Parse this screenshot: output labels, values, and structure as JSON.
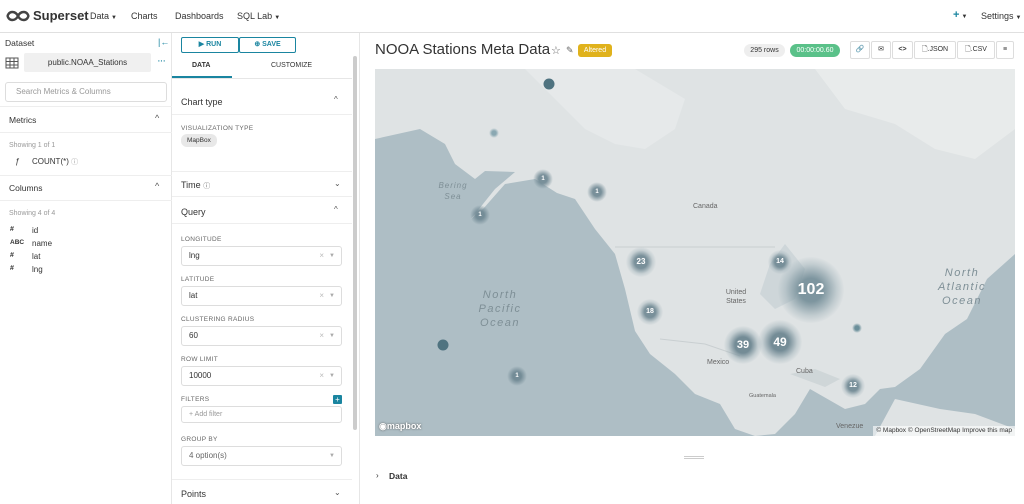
{
  "nav": {
    "brand": "Superset",
    "items": [
      "Data",
      "Charts",
      "Dashboards",
      "SQL Lab"
    ],
    "plus": "+",
    "settings": "Settings"
  },
  "dataset": {
    "heading": "Dataset",
    "name": "public.NOAA_Stations",
    "search_placeholder": "Search Metrics & Columns",
    "metrics_heading": "Metrics",
    "metrics_count": "Showing 1 of 1",
    "metric": "COUNT(*)",
    "columns_heading": "Columns",
    "columns_count": "Showing 4 of 4",
    "columns": [
      {
        "type": "#",
        "name": "id"
      },
      {
        "type": "ABC",
        "name": "name"
      },
      {
        "type": "#",
        "name": "lat"
      },
      {
        "type": "#",
        "name": "lng"
      }
    ]
  },
  "controls": {
    "run": "RUN",
    "save": "SAVE",
    "tab_data": "DATA",
    "tab_customize": "CUSTOMIZE",
    "chart_type": "Chart type",
    "viz_label": "VISUALIZATION TYPE",
    "viz_value": "MapBox",
    "time": "Time",
    "query": "Query",
    "longitude_label": "LONGITUDE",
    "longitude": "lng",
    "latitude_label": "LATITUDE",
    "latitude": "lat",
    "radius_label": "CLUSTERING RADIUS",
    "radius": "60",
    "row_limit_label": "ROW LIMIT",
    "row_limit": "10000",
    "filters_label": "FILTERS",
    "add_filter": "+ Add filter",
    "groupby_label": "GROUP BY",
    "groupby": "4 option(s)",
    "points": "Points"
  },
  "chart": {
    "title": "NOOA Stations Meta Data",
    "badge": "Altered",
    "rows": "295 rows",
    "timer": "00:00:00.60",
    "json": ".JSON",
    "csv": ".CSV",
    "data_section": "Data",
    "attribution": "© Mapbox © OpenStreetMap Improve this map",
    "mapbox_logo": "mapbox"
  },
  "map": {
    "labels": [
      "Canada",
      "United States",
      "Mexico",
      "Cuba",
      "Bering Sea",
      "Guatemala",
      "Venezue"
    ],
    "oceans": [
      "North Pacific Ocean",
      "North Atlantic Ocean"
    ],
    "clusters": [
      "102",
      "49",
      "39",
      "23",
      "18",
      "14",
      "12",
      "1",
      "1",
      "1",
      "1",
      "1",
      "1",
      "1"
    ]
  }
}
